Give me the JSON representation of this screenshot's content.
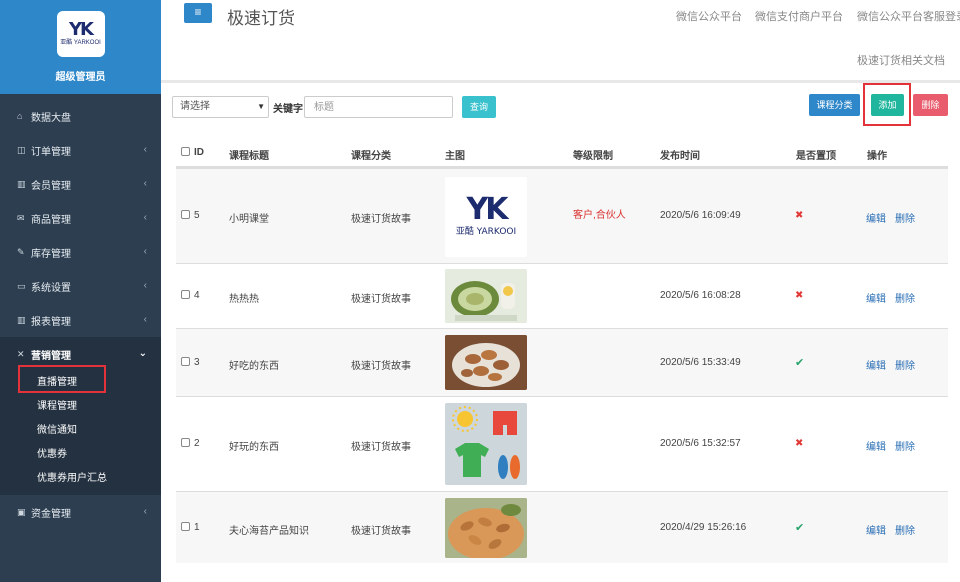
{
  "sidebar": {
    "logo_mark": "YK",
    "logo_sub": "亚酷 YARKOOI",
    "admin_name": "超级管理员",
    "items": [
      {
        "label": "数据大盘",
        "icon": "home-icon",
        "glyph": "⌂"
      },
      {
        "label": "订单管理",
        "icon": "columns-icon",
        "glyph": "◫"
      },
      {
        "label": "会员管理",
        "icon": "bar-chart-icon",
        "glyph": "▥"
      },
      {
        "label": "商品管理",
        "icon": "envelope-icon",
        "glyph": "✉"
      },
      {
        "label": "库存管理",
        "icon": "edit-icon",
        "glyph": "✎"
      },
      {
        "label": "系统设置",
        "icon": "desktop-icon",
        "glyph": "▭"
      },
      {
        "label": "报表管理",
        "icon": "bar-chart-icon",
        "glyph": "▥"
      },
      {
        "label": "营销管理",
        "icon": "cutlery-icon",
        "glyph": "✕"
      },
      {
        "label": "资金管理",
        "icon": "money-icon",
        "glyph": "▣"
      }
    ],
    "marketing_sub": [
      "直播管理",
      "课程管理",
      "微信通知",
      "优惠券",
      "优惠券用户汇总"
    ]
  },
  "header": {
    "title": "极速订货",
    "links": [
      "微信公众平台",
      "微信支付商户平台",
      "微信公众平台客服登录",
      "极速订货相关文档"
    ]
  },
  "toolbar": {
    "select_value": "请选择",
    "keyword_label": "关键字",
    "keyword_placeholder": "标题",
    "query_label": "查询",
    "category_label": "课程分类",
    "add_label": "添加",
    "delete_label": "删除"
  },
  "table": {
    "columns": [
      "ID",
      "课程标题",
      "课程分类",
      "主图",
      "等级限制",
      "发布时间",
      "是否置顶",
      "操作"
    ],
    "rows": [
      {
        "id": "5",
        "title": "小明课堂",
        "category": "极速订货故事",
        "image": "yarkooi-logo",
        "level": "客户,合伙人",
        "time": "2020/5/6 16:09:49",
        "pinned": false,
        "edit": "编辑",
        "delete": "删除"
      },
      {
        "id": "4",
        "title": "热热热",
        "category": "极速订货故事",
        "image": "melon-photo",
        "level": "",
        "time": "2020/5/6 16:08:28",
        "pinned": false,
        "edit": "编辑",
        "delete": "删除"
      },
      {
        "id": "3",
        "title": "好吃的东西",
        "category": "极速订货故事",
        "image": "pecan-photo",
        "level": "",
        "time": "2020/5/6 15:33:49",
        "pinned": true,
        "edit": "编辑",
        "delete": "删除"
      },
      {
        "id": "2",
        "title": "好玩的东西",
        "category": "极速订货故事",
        "image": "summer-items-photo",
        "level": "",
        "time": "2020/5/6 15:32:57",
        "pinned": false,
        "edit": "编辑",
        "delete": "删除"
      },
      {
        "id": "1",
        "title": "夫心海苔产品知识",
        "category": "极速订货故事",
        "image": "almond-photo",
        "level": "",
        "time": "2020/4/29 15:26:16",
        "pinned": true,
        "edit": "编辑",
        "delete": "删除"
      }
    ]
  },
  "colors": {
    "sidebar_bg": "#2c3e50",
    "brand_blue": "#2e87c9",
    "add_green": "#20b59d",
    "delete_red": "#e85c6d",
    "query_cyan": "#39c1ce",
    "highlight_red": "#e3323a"
  }
}
